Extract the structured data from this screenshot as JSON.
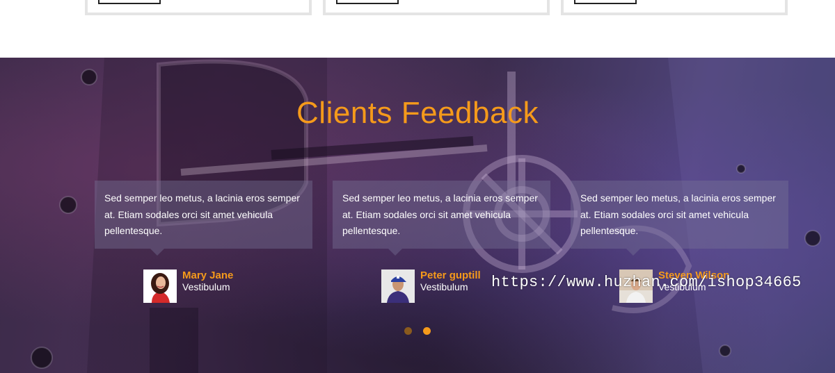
{
  "section": {
    "title": "Clients Feedback"
  },
  "testimonials": [
    {
      "text": "Sed semper leo metus, a lacinia eros semper at. Etiam sodales orci sit amet vehicula pellentesque.",
      "name": "Mary Jane",
      "role": "Vestibulum"
    },
    {
      "text": "Sed semper leo metus, a lacinia eros semper at. Etiam sodales orci sit amet vehicula pellentesque.",
      "name": "Peter guptill",
      "role": "Vestibulum"
    },
    {
      "text": "Sed semper leo metus, a lacinia eros semper at. Etiam sodales orci sit amet vehicula pellentesque.",
      "name": "Steven Wilson",
      "role": "Vestibulum"
    }
  ],
  "carousel": {
    "dot_count": 2,
    "active_index": 1
  },
  "watermark": "https://www.huzhan.com/ishop34665",
  "colors": {
    "accent": "#f59a1b",
    "bubble": "rgba(120,115,150,0.42)",
    "card_border": "#e4e4e4"
  }
}
